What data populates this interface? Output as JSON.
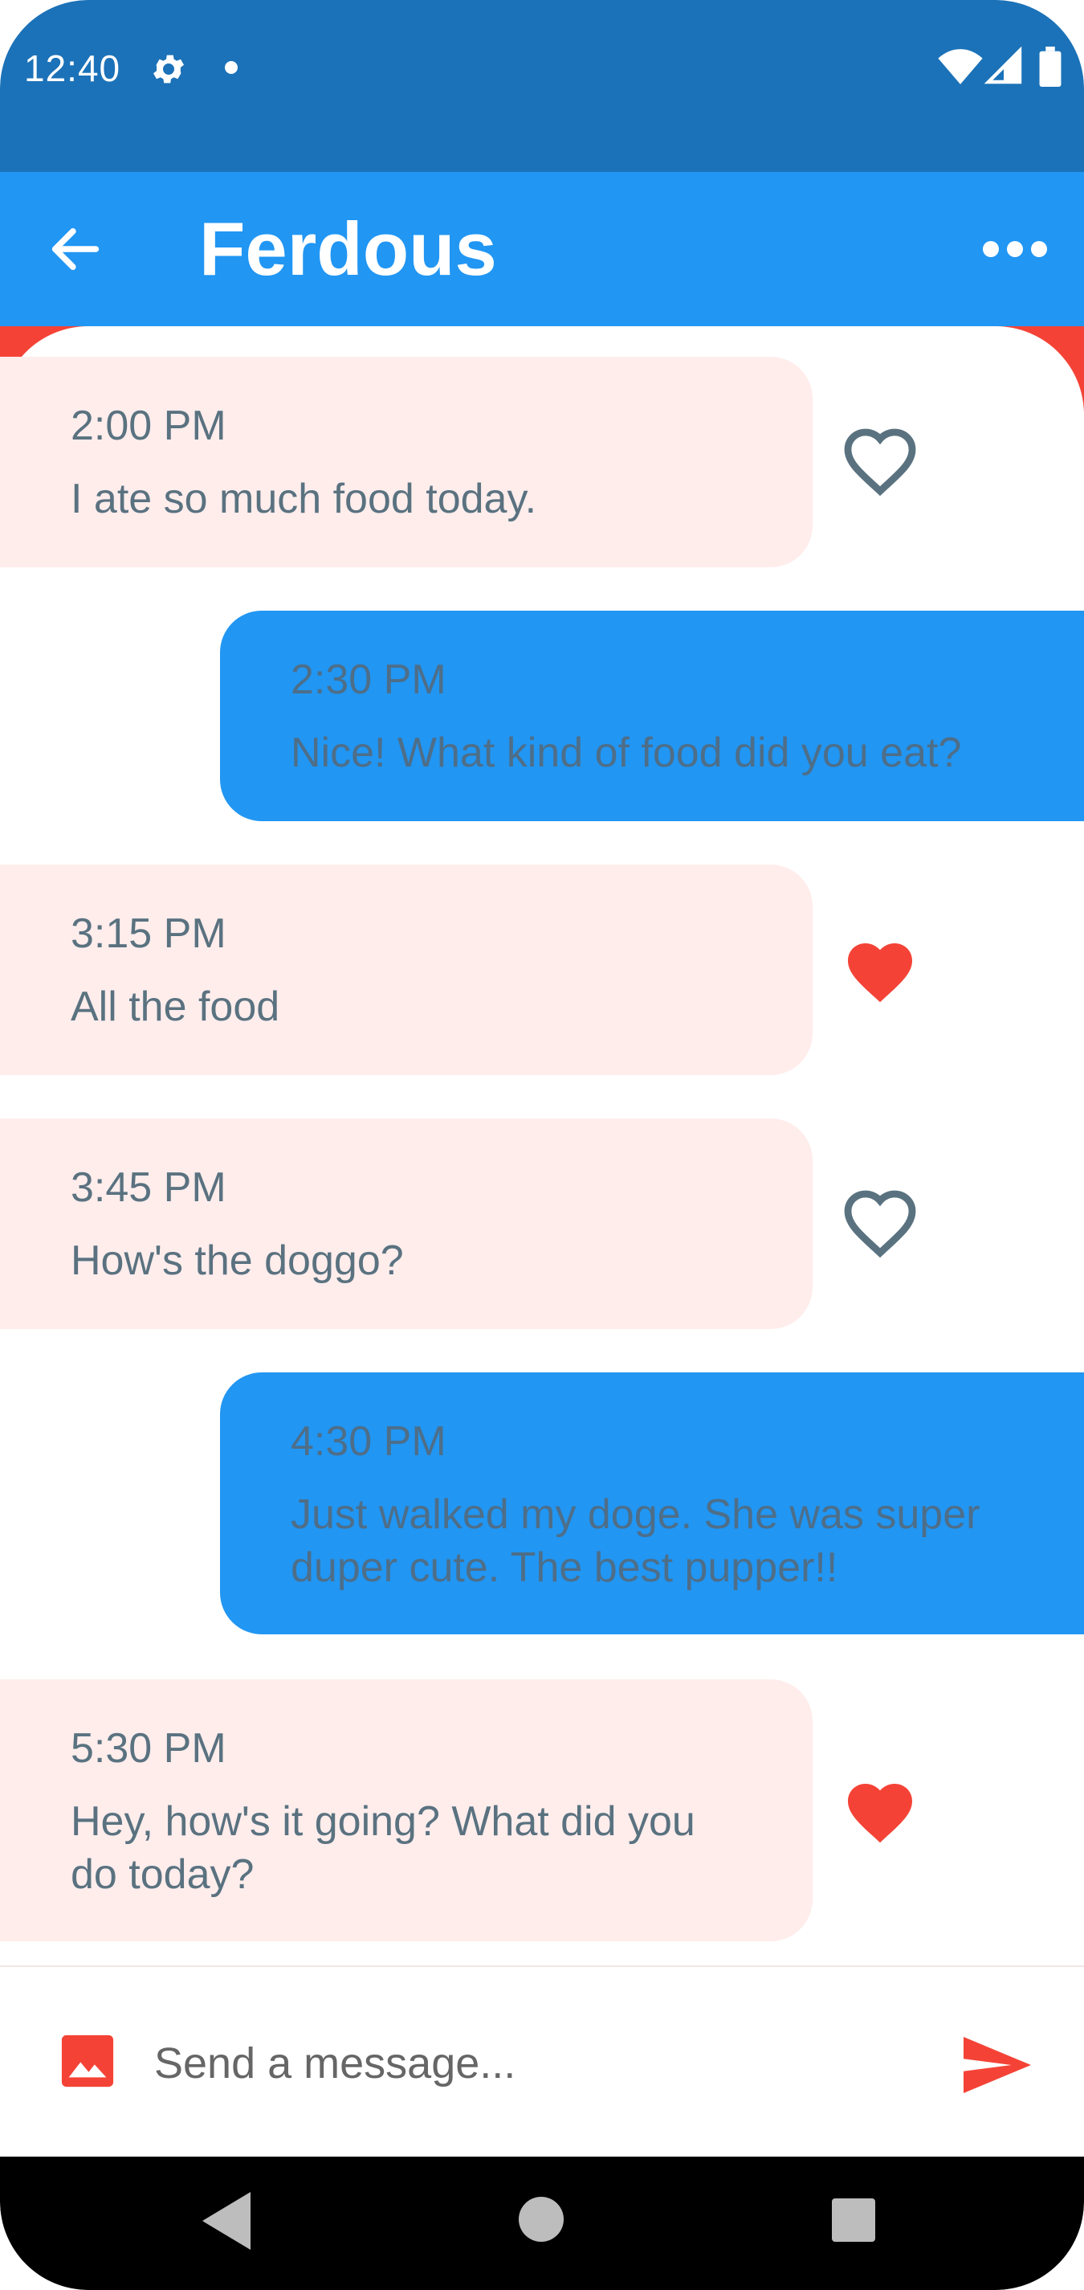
{
  "status_bar": {
    "time": "12:40",
    "icons": [
      "gear-icon",
      "dot-icon",
      "wifi-icon",
      "signal-icon",
      "battery-icon"
    ]
  },
  "app_bar": {
    "title": "Ferdous",
    "back_icon": "arrow-left-icon",
    "menu_icon": "more-horizontal-icon"
  },
  "colors": {
    "status_bar": "#1b72b8",
    "app_bar": "#2196f3",
    "received_bubble": "#ffedec",
    "sent_bubble": "#2196f3",
    "accent_red": "#f44336",
    "text": "#5a7280"
  },
  "messages": [
    {
      "direction": "received",
      "time": "2:00 PM",
      "text": "I ate so much food today.",
      "liked": false
    },
    {
      "direction": "sent",
      "time": "2:30 PM",
      "text": "Nice! What kind of food did you eat?"
    },
    {
      "direction": "received",
      "time": "3:15 PM",
      "text": "All the food",
      "liked": true
    },
    {
      "direction": "received",
      "time": "3:45 PM",
      "text": "How's the doggo?",
      "liked": false
    },
    {
      "direction": "sent",
      "time": "4:30 PM",
      "text": "Just walked my doge. She was super duper cute. The best pupper!!"
    },
    {
      "direction": "received",
      "time": "5:30 PM",
      "text": "Hey, how's it going? What did you do today?",
      "liked": true
    }
  ],
  "composer": {
    "placeholder": "Send a message...",
    "image_icon": "image-icon",
    "send_icon": "send-icon"
  },
  "nav_bar": {
    "icons": [
      "nav-back-icon",
      "nav-home-icon",
      "nav-recents-icon"
    ]
  }
}
